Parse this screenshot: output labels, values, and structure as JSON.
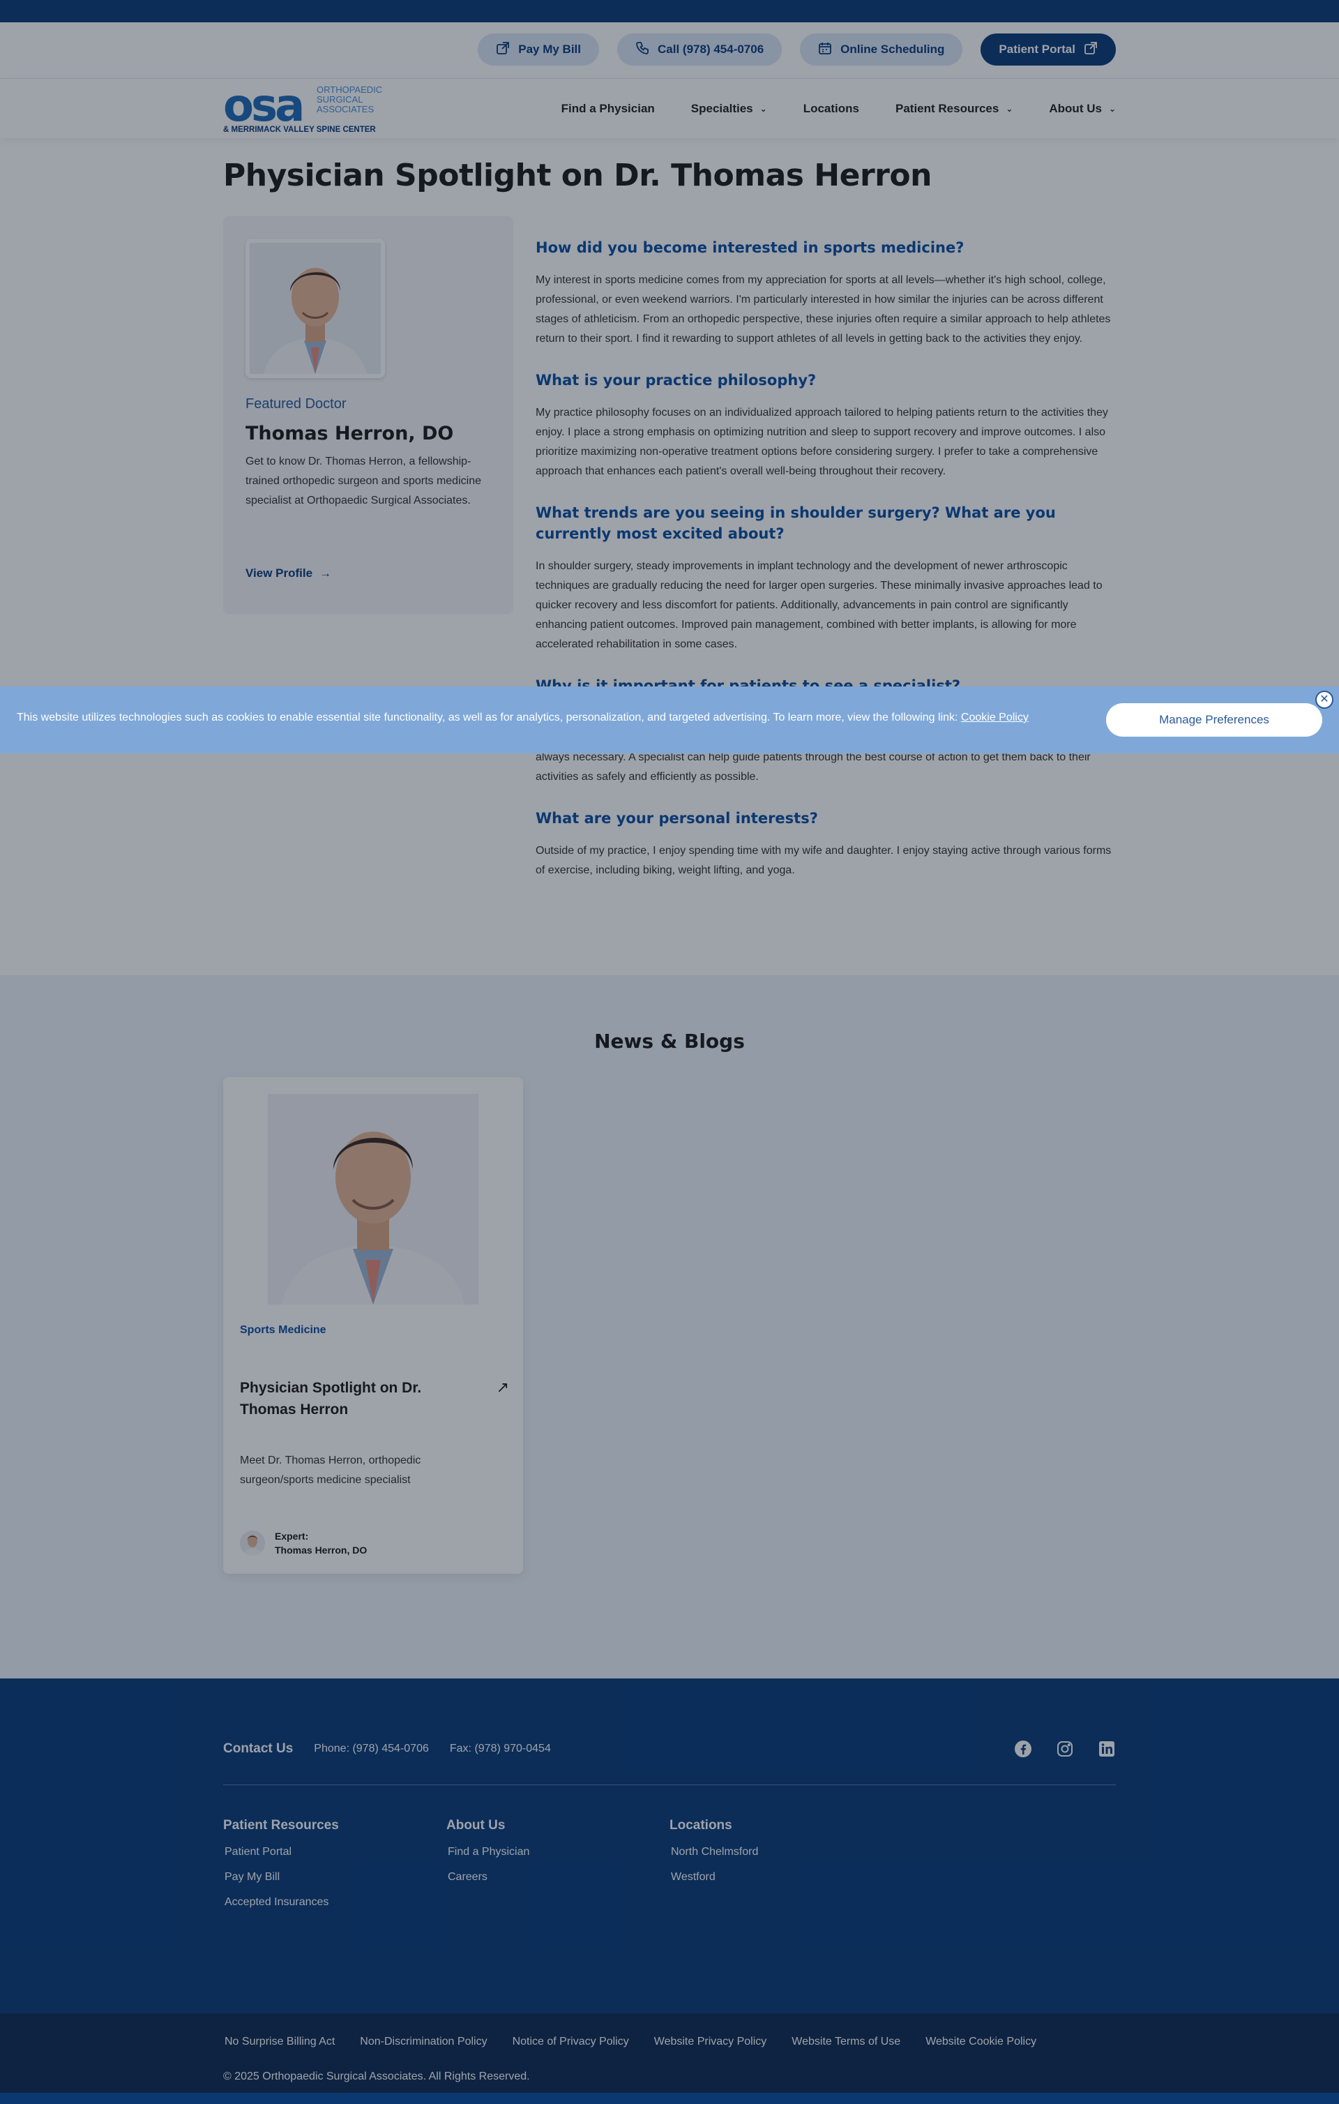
{
  "utility": {
    "pay_bill": "Pay My Bill",
    "call": "Call (978) 454-0706",
    "scheduling": "Online Scheduling",
    "portal": "Patient Portal"
  },
  "logo": {
    "mark": "osa",
    "line1": "ORTHOPAEDIC",
    "line2": "SURGICAL",
    "line3": "ASSOCIATES",
    "line4": "& MERRIMACK VALLEY SPINE CENTER"
  },
  "nav": {
    "items": [
      {
        "label": "Find a Physician"
      },
      {
        "label": "Specialties"
      },
      {
        "label": "Locations"
      },
      {
        "label": "Patient Resources"
      },
      {
        "label": "About Us"
      }
    ]
  },
  "page": {
    "title": "Physician Spotlight on Dr. Thomas Herron"
  },
  "doctor_card": {
    "eyebrow": "Featured Doctor",
    "name": "Thomas Herron, DO",
    "description": "Get to know Dr. Thomas Herron, a fellowship-trained orthopedic surgeon and sports medicine specialist at Orthopaedic Surgical Associates.",
    "link": "View Profile"
  },
  "qa": [
    {
      "q": "How did you become interested in sports medicine?",
      "a": "My interest in sports medicine comes from my appreciation for sports at all levels—whether it's high school, college, professional, or even weekend warriors. I'm particularly interested in how similar the injuries can be across different stages of athleticism. From an orthopedic perspective, these injuries often require a similar approach to help athletes return to their sport. I find it rewarding to support athletes of all levels in getting back to the activities they enjoy."
    },
    {
      "q": "What is your practice philosophy?",
      "a": "My practice philosophy focuses on an individualized approach tailored to helping patients return to the activities they enjoy. I place a strong emphasis on optimizing nutrition and sleep to support recovery and improve outcomes. I also prioritize maximizing non-operative treatment options before considering surgery. I prefer to take a comprehensive approach that enhances each patient's overall well-being throughout their recovery."
    },
    {
      "q": "What trends are you seeing in shoulder surgery? What are you currently most excited about?",
      "a": "In shoulder surgery, steady improvements in implant technology and the development of newer arthroscopic techniques are gradually reducing the need for larger open surgeries. These minimally invasive approaches lead to quicker recovery and less discomfort for patients. Additionally, advancements in pain control are significantly enhancing patient outcomes. Improved pain management, combined with better implants, is allowing for more accelerated rehabilitation in some cases."
    },
    {
      "q": "Why is it important for patients to see a specialist?",
      "a": "It's important for patients to see a specialist because a specialist can accurately diagnose the issue and develop a tailored treatment plan. In sports medicine, this often means exploring non-surgical options first, as surgery isn't always necessary. A specialist can help guide patients through the best course of action to get them back to their activities as safely and efficiently as possible."
    },
    {
      "q": "What are your personal interests?",
      "a": "Outside of my practice, I enjoy spending time with my wife and daughter. I enjoy staying active through various forms of exercise, including biking, weight lifting, and yoga."
    }
  ],
  "news": {
    "title": "News & Blogs",
    "card": {
      "category": "Sports Medicine",
      "headline": "Physician Spotlight on Dr. Thomas Herron",
      "arrow": "↗",
      "description": "Meet Dr. Thomas Herron, orthopedic surgeon/sports medicine specialist",
      "expert_label": "Expert:",
      "expert_name": "Thomas Herron, DO"
    }
  },
  "footer": {
    "contact_label": "Contact Us",
    "phone": "Phone: (978) 454-0706",
    "fax": "Fax: (978) 970-0454",
    "social": [
      "facebook-icon",
      "instagram-icon",
      "linkedin-icon"
    ],
    "columns": [
      {
        "title": "Patient Resources",
        "links": [
          "Patient Portal",
          "Pay My Bill",
          "Accepted Insurances"
        ]
      },
      {
        "title": "About Us",
        "links": [
          "Find a Physician",
          "Careers"
        ]
      },
      {
        "title": "Locations",
        "links": [
          "North Chelmsford",
          "Westford"
        ]
      }
    ],
    "legal_links": [
      "No Surprise Billing Act",
      "Non-Discrimination Policy",
      "Notice of Privacy Policy",
      "Website Privacy Policy",
      "Website Terms of Use",
      "Website Cookie Policy"
    ],
    "copyright": "© 2025 Orthopaedic Surgical Associates. All Rights Reserved."
  },
  "cookie": {
    "text": "This website utilizes technologies such as cookies to enable essential site functionality, as well as for analytics, personalization, and targeted advertising. To learn more, view the following link:",
    "link": "Cookie Policy",
    "button": "Manage Preferences",
    "close": "✕"
  },
  "colors": {
    "brand_navy": "#0b3d79",
    "brand_blue": "#0b4fa0",
    "pill_bg": "#dbe7f7",
    "cookie_bg": "#7fa8d8"
  }
}
